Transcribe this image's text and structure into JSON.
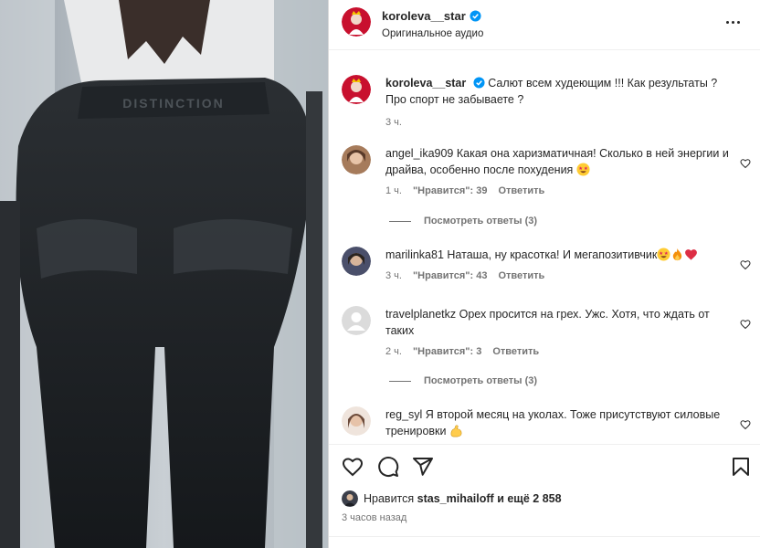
{
  "post": {
    "username": "koroleva__star",
    "audio": "Оригинальное аудио",
    "caption_user": "koroleva__star",
    "caption": "Салют всем худеющим !!! Как результаты ? Про спорт не забываете ?",
    "caption_time": "3 ч.",
    "media_text": "DISTINCTION"
  },
  "comments": [
    {
      "user": "angel_ika909",
      "text": "Какая она харизматичная! Сколько в ней энергии и драйва, особенно после похудения",
      "emoji": [
        "star-struck"
      ],
      "time": "1 ч.",
      "likes": "\"Нравится\": 39",
      "reply": "Ответить",
      "view_replies": "Посмотреть ответы (3)"
    },
    {
      "user": "marilinka81",
      "text": "Наташа, ну красотка! И мегапозитивчик",
      "emoji": [
        "star-struck",
        "fire",
        "red-heart"
      ],
      "time": "3 ч.",
      "likes": "\"Нравится\": 43",
      "reply": "Ответить"
    },
    {
      "user": "travelplanetkz",
      "text": "Орех просится на грех. Ужс. Хотя, что ждать от таких",
      "time": "2 ч.",
      "likes": "\"Нравится\": 3",
      "reply": "Ответить",
      "view_replies": "Посмотреть ответы (3)"
    },
    {
      "user": "reg_syl",
      "text": "Я второй месяц на уколах. Тоже присутствуют силовые тренировки",
      "emoji": [
        "flexed-biceps"
      ]
    }
  ],
  "actions": {
    "likes_prefix": "Нравится",
    "liked_by": "stas_mihailoff",
    "likes_rest": "и ещё 2 858",
    "time_ago": "3 часов назад"
  },
  "icons": {
    "like": "heart-icon",
    "comment": "comment-icon",
    "share": "share-icon",
    "save": "bookmark-icon",
    "more": "more-icon",
    "verified": "verified-badge-icon"
  },
  "colors": {
    "verified": "#0095f6",
    "heart": "#ed4956",
    "secondary_text": "#737373"
  }
}
